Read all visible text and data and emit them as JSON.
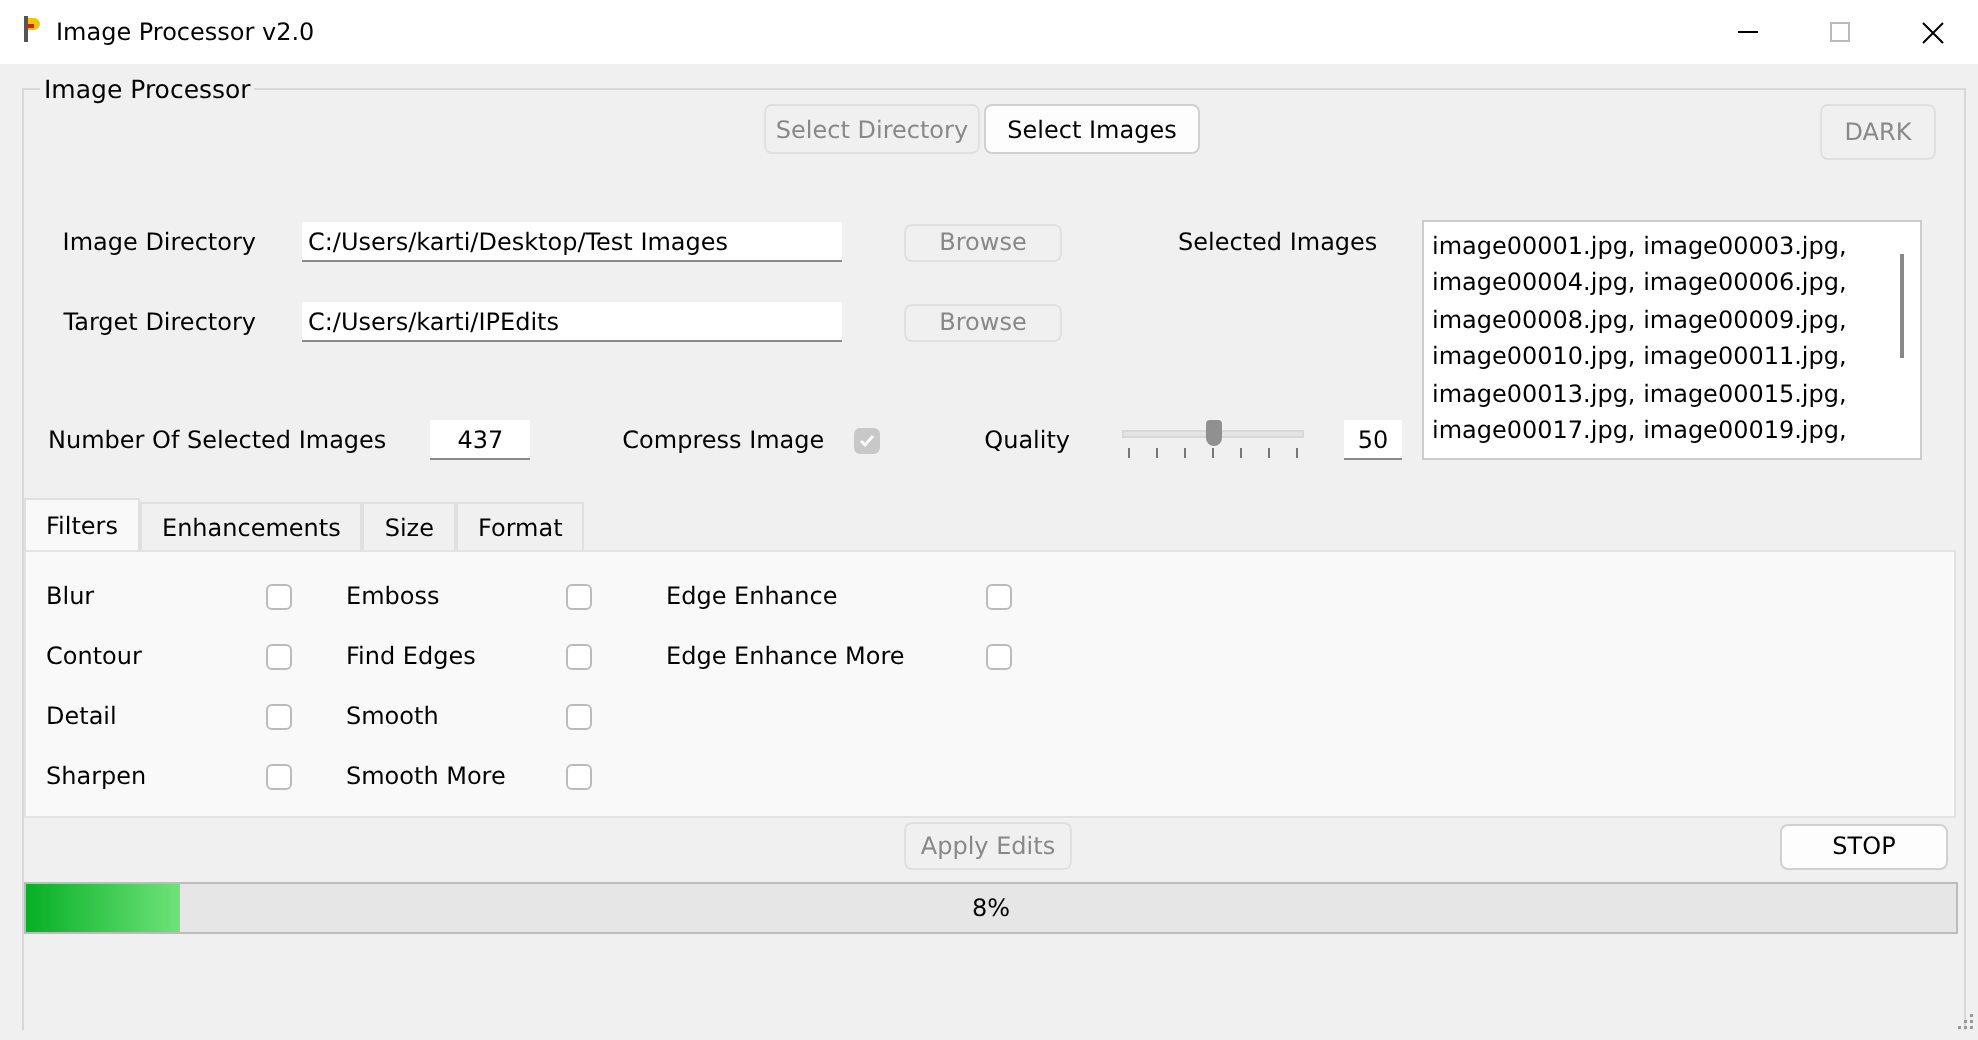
{
  "window": {
    "title": "Image Processor v2.0"
  },
  "group": {
    "title": "Image Processor"
  },
  "mode_buttons": [
    {
      "label": "Select Directory",
      "selected": false
    },
    {
      "label": "Select Images",
      "selected": true
    }
  ],
  "theme_button": {
    "label": "DARK",
    "disabled": true
  },
  "image_directory": {
    "label": "Image Directory",
    "value": "C:/Users/karti/Desktop/Test Images",
    "browse": "Browse",
    "disabled": true
  },
  "target_directory": {
    "label": "Target Directory",
    "value": "C:/Users/karti/IPEdits",
    "browse": "Browse",
    "disabled": true
  },
  "selected_images": {
    "label": "Selected Images",
    "lines": [
      "image00001.jpg, image00003.jpg,",
      "image00004.jpg, image00006.jpg,",
      "image00008.jpg, image00009.jpg,",
      "image00010.jpg, image00011.jpg,",
      "image00013.jpg, image00015.jpg,",
      "image00017.jpg, image00019.jpg,"
    ]
  },
  "count": {
    "label": "Number Of Selected Images",
    "value": "437"
  },
  "compress": {
    "label": "Compress Image",
    "checked": true,
    "disabled": true
  },
  "quality": {
    "label": "Quality",
    "level": 0.5,
    "value": "50"
  },
  "tabs": [
    {
      "label": "Filters",
      "selected": true
    },
    {
      "label": "Enhancements",
      "selected": false
    },
    {
      "label": "Size",
      "selected": false
    },
    {
      "label": "Format",
      "selected": false
    }
  ],
  "filter_columns": [
    {
      "items": [
        {
          "label": "Blur",
          "checked": false
        },
        {
          "label": "Contour",
          "checked": false
        },
        {
          "label": "Detail",
          "checked": false
        },
        {
          "label": "Sharpen",
          "checked": false
        }
      ]
    },
    {
      "items": [
        {
          "label": "Emboss",
          "checked": false
        },
        {
          "label": "Find Edges",
          "checked": false
        },
        {
          "label": "Smooth",
          "checked": false
        },
        {
          "label": "Smooth More",
          "checked": false
        }
      ]
    },
    {
      "items": [
        {
          "label": "Edge Enhance",
          "checked": false
        },
        {
          "label": "Edge Enhance More",
          "checked": false
        }
      ]
    }
  ],
  "apply_button": {
    "label": "Apply Edits",
    "disabled": true
  },
  "stop_button": {
    "label": "STOP",
    "disabled": false
  },
  "progress": {
    "level": 0.08,
    "text": "8%"
  }
}
